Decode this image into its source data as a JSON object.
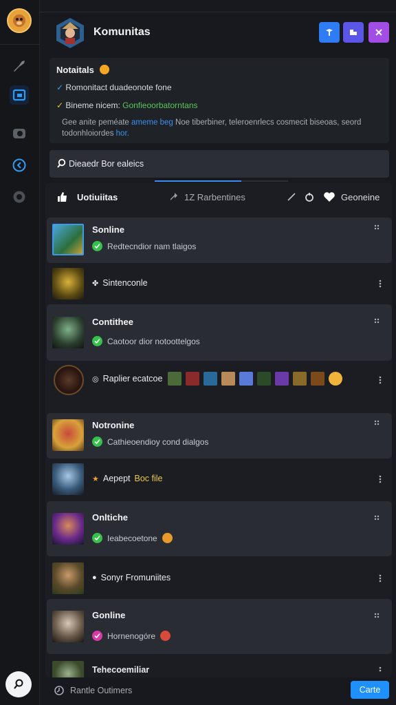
{
  "app": {
    "title": "Komunitas",
    "accent": "#3b8ff0",
    "header_buttons": [
      {
        "icon": "pin-icon",
        "color": "#2f7df6"
      },
      {
        "icon": "chat-icon",
        "color": "#5b55e8"
      },
      {
        "icon": "close-icon",
        "color": "#a24ee6"
      }
    ]
  },
  "notice": {
    "title": "Notaitals",
    "line1": "Romonitact duadeonote fone",
    "line2_a": "Bineme nicem:",
    "line2_b": "Gonfieoorbatorntans",
    "desc_a": "Gee anite peméate",
    "desc_link1": "ameme beg",
    "desc_b": "Noe tiberbiner, teleroenrlecs cosmecit biseoas, seord todonhloiordes",
    "desc_link2": "hor."
  },
  "search": {
    "placeholder": "Dieaedr Bor ealeics"
  },
  "tabs": {
    "left": "Uotiuiitas",
    "middle": "1Z Rarbentines",
    "right": "Geoneine",
    "progress": 0.65
  },
  "rows": [
    {
      "type": "card",
      "name": "Sonline",
      "status": "Redtecndior nam tlaigos"
    },
    {
      "type": "plain",
      "name": "Sintenconle",
      "icon": "users-icon"
    },
    {
      "type": "card",
      "name": "Contithee",
      "status": "Caotoor dior notoottelgos"
    },
    {
      "type": "plain",
      "name": "Raplier ecatcoe",
      "icon": "circle-icon",
      "avatars": 11
    },
    {
      "type": "card",
      "name": "Notronine",
      "status": "Cathieoendioy cond dialgos"
    },
    {
      "type": "plain",
      "name": "Aepept",
      "name_b": "Boc file",
      "icon": "star-icon"
    },
    {
      "type": "card",
      "name": "Onltiche",
      "status": "Ieabecoetone"
    },
    {
      "type": "plain",
      "name": "Sonyr Fromuniites",
      "icon": "chat-icon"
    },
    {
      "type": "card",
      "name": "Gonline",
      "status": "Hornenogóre"
    },
    {
      "type": "plain",
      "name": "Tehecoemiliar"
    }
  ],
  "footer": {
    "text": "Rantle Outimers",
    "button": "Carte"
  }
}
